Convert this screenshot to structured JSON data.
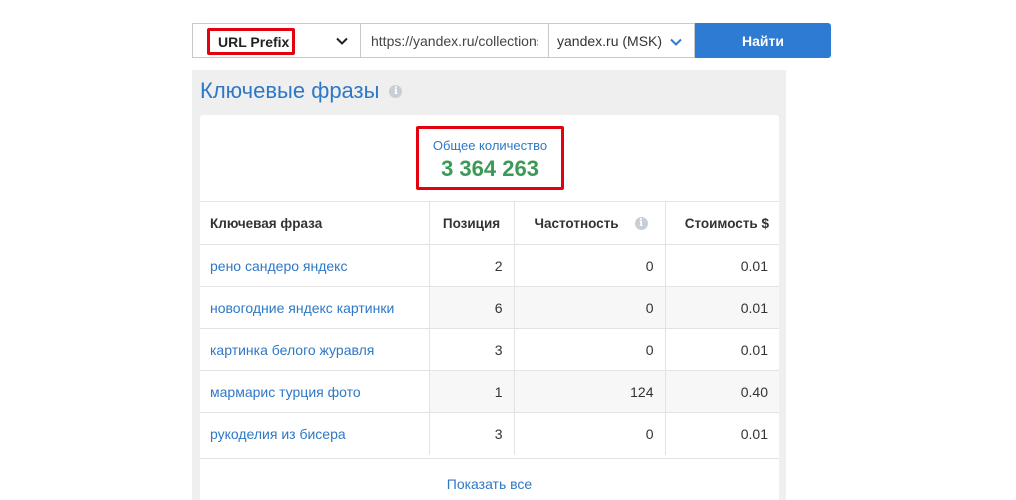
{
  "search": {
    "mode": "URL Prefix",
    "url_value": "https://yandex.ru/collections/",
    "region": "yandex.ru (MSK)",
    "find_label": "Найти"
  },
  "panel": {
    "title": "Ключевые фразы",
    "total_label": "Общее количество",
    "total_value": "3 364 263"
  },
  "table": {
    "headers": [
      "Ключевая фраза",
      "Позиция",
      "Частотность",
      "Стоимость $"
    ],
    "rows": [
      [
        "рено сандеро яндекс",
        "2",
        "0",
        "0.01"
      ],
      [
        "новогодние яндекс картинки",
        "6",
        "0",
        "0.01"
      ],
      [
        "картинка белого журавля",
        "3",
        "0",
        "0.01"
      ],
      [
        "мармарис турция фото",
        "1",
        "124",
        "0.40"
      ],
      [
        "рукоделия из бисера",
        "3",
        "0",
        "0.01"
      ]
    ]
  },
  "show_all_label": "Показать все",
  "colors": {
    "accent": "#2d7bd2",
    "link": "#2e78c7",
    "total": "#3b9a55",
    "highlight": "#e3000f"
  }
}
